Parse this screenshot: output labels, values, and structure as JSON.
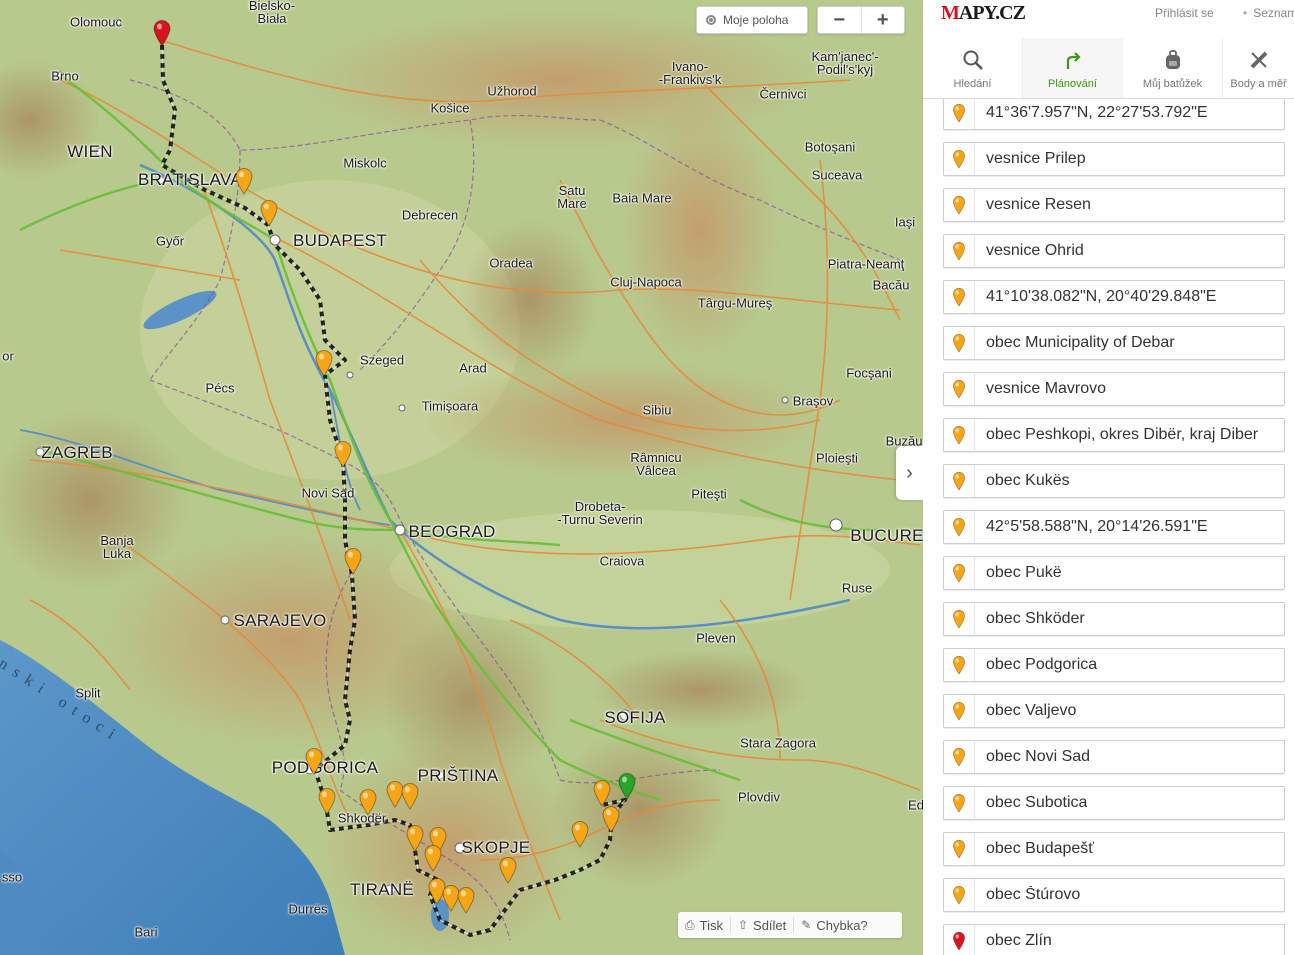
{
  "map": {
    "my_position_label": "Moje poloha",
    "zoom_out": "−",
    "zoom_in": "+",
    "collapse_icon": "chevron-right-icon",
    "sea_label": "nski otoci",
    "bottom_bar": {
      "print": "Tisk",
      "share": "Sdílet",
      "error": "Chybka?"
    },
    "cities": [
      {
        "name": "Olomouc",
        "big": false
      },
      {
        "name": "Bielsko-\nBiała",
        "big": false
      },
      {
        "name": "Brno",
        "big": false
      },
      {
        "name": "WIEN",
        "big": true
      },
      {
        "name": "BRATISLAVA",
        "big": true
      },
      {
        "name": "Győr",
        "big": false
      },
      {
        "name": "BUDAPEST",
        "big": true
      },
      {
        "name": "Miskolc",
        "big": false
      },
      {
        "name": "Košice",
        "big": false
      },
      {
        "name": "Užhorod",
        "big": false
      },
      {
        "name": "Debrecen",
        "big": false
      },
      {
        "name": "Ivano-\n-Frankivs'k",
        "big": false
      },
      {
        "name": "Kam'janec'-\nPodil's'kyj",
        "big": false
      },
      {
        "name": "Černivci",
        "big": false
      },
      {
        "name": "Botoşani",
        "big": false
      },
      {
        "name": "Suceava",
        "big": false
      },
      {
        "name": "Satu\nMare",
        "big": false
      },
      {
        "name": "Baia Mare",
        "big": false
      },
      {
        "name": "Iaşi",
        "big": false
      },
      {
        "name": "Oradea",
        "big": false
      },
      {
        "name": "Cluj-Napoca",
        "big": false
      },
      {
        "name": "Târgu-Mureş",
        "big": false
      },
      {
        "name": "Piatra-Neamţ",
        "big": false
      },
      {
        "name": "Bacău",
        "big": false
      },
      {
        "name": "Szeged",
        "big": false
      },
      {
        "name": "Arad",
        "big": false
      },
      {
        "name": "Pécs",
        "big": false
      },
      {
        "name": "Timişoara",
        "big": false
      },
      {
        "name": "Sibiu",
        "big": false
      },
      {
        "name": "Focşani",
        "big": false
      },
      {
        "name": "Braşov",
        "big": false
      },
      {
        "name": "Buzău",
        "big": false
      },
      {
        "name": "ZAGREB",
        "big": true
      },
      {
        "name": "Novi Sad",
        "big": false
      },
      {
        "name": "Râmnicu\nVâlcea",
        "big": false
      },
      {
        "name": "Ploieşti",
        "big": false
      },
      {
        "name": "Piteşti",
        "big": false
      },
      {
        "name": "BEOGRAD",
        "big": true
      },
      {
        "name": "Drobeta-\n-Turnu Severin",
        "big": false
      },
      {
        "name": "BUCURE",
        "big": true
      },
      {
        "name": "Banja\nLuka",
        "big": false
      },
      {
        "name": "Craiova",
        "big": false
      },
      {
        "name": "Ruse",
        "big": false
      },
      {
        "name": "SARAJEVO",
        "big": true
      },
      {
        "name": "Pleven",
        "big": false
      },
      {
        "name": "Split",
        "big": false
      },
      {
        "name": "SOFIJA",
        "big": true
      },
      {
        "name": "Stara Zagora",
        "big": false
      },
      {
        "name": "PODGORICA",
        "big": true
      },
      {
        "name": "PRIŠTINA",
        "big": true
      },
      {
        "name": "Plovdiv",
        "big": false
      },
      {
        "name": "Shkodër",
        "big": false
      },
      {
        "name": "SKOPJE",
        "big": true
      },
      {
        "name": "TIRANË",
        "big": true
      },
      {
        "name": "Durrës",
        "big": false
      },
      {
        "name": "Bari",
        "big": false
      },
      {
        "name": "sso",
        "big": false
      },
      {
        "name": "or",
        "big": false
      },
      {
        "name": "Ed",
        "big": false
      }
    ]
  },
  "sidebar": {
    "logo": "MAPY.CZ",
    "login": "Přihlásit se",
    "seznam": "Seznam",
    "tabs": [
      {
        "label": "Hledání",
        "icon": "search-icon",
        "active": false
      },
      {
        "label": "Plánování",
        "icon": "route-icon",
        "active": true
      },
      {
        "label": "Můj batůžek",
        "icon": "backpack-icon",
        "active": false
      },
      {
        "label": "Body a měř",
        "icon": "ruler-icon",
        "active": false
      }
    ],
    "stops": [
      {
        "label": "41°36'7.957\"N, 22°27'53.792\"E",
        "pin": "orange"
      },
      {
        "label": "vesnice Prilep",
        "pin": "orange"
      },
      {
        "label": "vesnice Resen",
        "pin": "orange"
      },
      {
        "label": "vesnice Ohrid",
        "pin": "orange"
      },
      {
        "label": "41°10'38.082\"N, 20°40'29.848\"E",
        "pin": "orange"
      },
      {
        "label": "obec Municipality of Debar",
        "pin": "orange"
      },
      {
        "label": "vesnice Mavrovo",
        "pin": "orange"
      },
      {
        "label": "obec Peshkopi, okres Dibër, kraj Diber",
        "pin": "orange"
      },
      {
        "label": "obec Kukës",
        "pin": "orange"
      },
      {
        "label": "42°5'58.588\"N, 20°14'26.591\"E",
        "pin": "orange"
      },
      {
        "label": "obec Pukë",
        "pin": "orange"
      },
      {
        "label": "obec Shköder",
        "pin": "orange"
      },
      {
        "label": "obec Podgorica",
        "pin": "orange"
      },
      {
        "label": "obec Valjevo",
        "pin": "orange"
      },
      {
        "label": "obec Novi Sad",
        "pin": "orange"
      },
      {
        "label": "obec Subotica",
        "pin": "orange"
      },
      {
        "label": "obec Budapešť",
        "pin": "orange"
      },
      {
        "label": "obec Štúrovo",
        "pin": "orange"
      },
      {
        "label": "obec Zlín",
        "pin": "red"
      }
    ],
    "colors": {
      "accent": "#3a9a12",
      "pin_orange": "#f5a516",
      "pin_red": "#d9141e",
      "pin_green": "#2aa32a"
    }
  }
}
